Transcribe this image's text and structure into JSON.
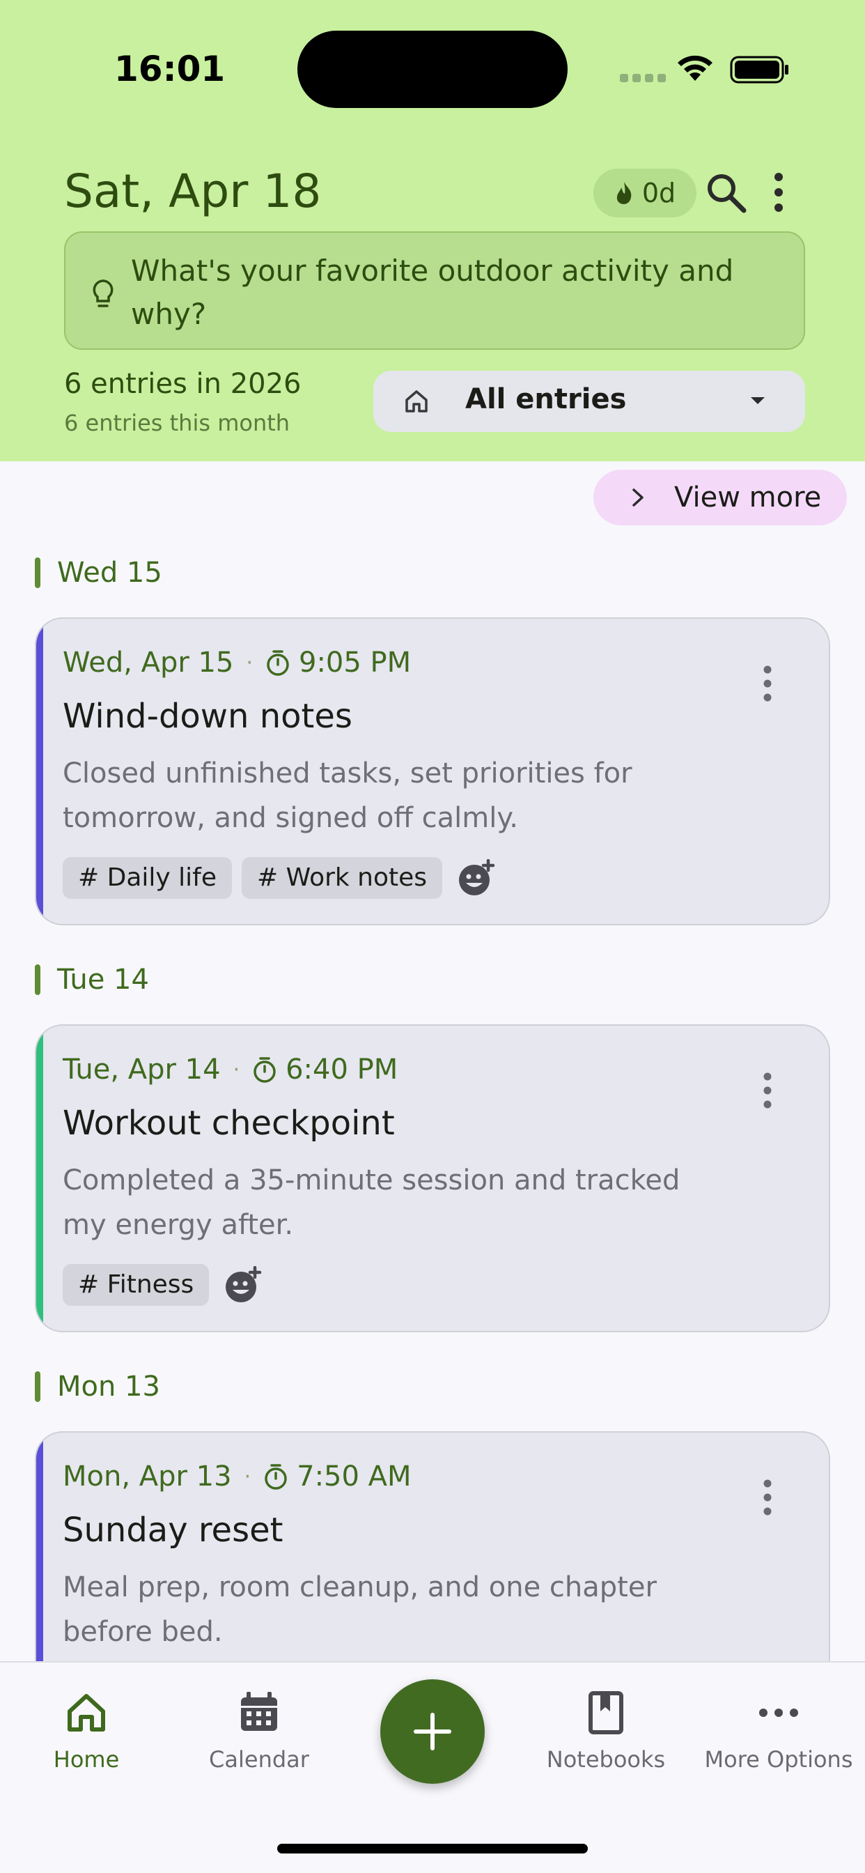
{
  "status_bar": {
    "time": "16:01"
  },
  "header": {
    "date": "Sat, Apr 18",
    "streak": "0d",
    "prompt": "What's your favorite outdoor activity and why?",
    "year_count": "6 entries in 2026",
    "month_count": "6 entries this month",
    "filter": "All entries"
  },
  "view_more": "View more",
  "days": [
    {
      "label": "Wed 15",
      "entry": {
        "date": "Wed, Apr 15",
        "time": "9:05 PM",
        "title": "Wind-down notes",
        "body": "Closed unfinished tasks, set priorities for tomorrow, and signed off calmly.",
        "tags": [
          "# Daily life",
          "# Work notes"
        ],
        "accent": "#5a4fd6"
      }
    },
    {
      "label": "Tue 14",
      "entry": {
        "date": "Tue, Apr 14",
        "time": "6:40 PM",
        "title": "Workout checkpoint",
        "body": "Completed a 35-minute session and tracked my energy after.",
        "tags": [
          "# Fitness"
        ],
        "accent": "#2fbf7e"
      }
    },
    {
      "label": "Mon 13",
      "entry": {
        "date": "Mon, Apr 13",
        "time": "7:50 AM",
        "title": "Sunday reset",
        "body": "Meal prep, room cleanup, and one chapter before bed.",
        "tags": [],
        "accent": "#5a4fd6"
      }
    }
  ],
  "nav": {
    "home": "Home",
    "calendar": "Calendar",
    "notebooks": "Notebooks",
    "more": "More Options"
  },
  "icons": {
    "streak": "flame-icon",
    "search": "search-icon",
    "overflow": "more-vert-icon",
    "prompt": "lightbulb-icon",
    "filter": "home-icon",
    "fab": "plus-icon"
  }
}
